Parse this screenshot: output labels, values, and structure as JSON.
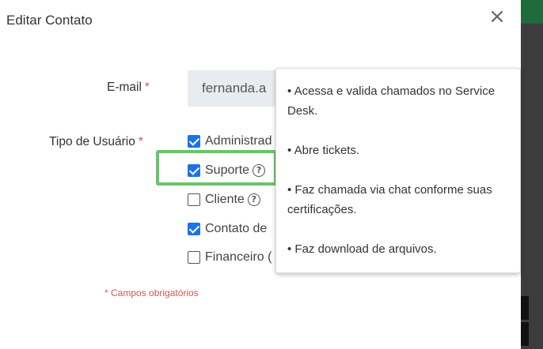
{
  "modal": {
    "title": "Editar Contato",
    "close_glyph": "×"
  },
  "form": {
    "email_label": "E-mail",
    "email_value": "fernanda.a",
    "user_type_label": "Tipo de Usuário",
    "required_marker": "*",
    "user_types": [
      {
        "label": "Administrad",
        "checked": true,
        "help": false
      },
      {
        "label": "Suporte",
        "checked": true,
        "help": true
      },
      {
        "label": "Cliente",
        "checked": false,
        "help": true
      },
      {
        "label": "Contato de",
        "checked": true,
        "help": false
      },
      {
        "label": "Financeiro (",
        "checked": false,
        "help": false
      }
    ],
    "required_note": "* Campos obrigatórios"
  },
  "tooltip": {
    "items": [
      "• Acessa e valida chamados no Service Desk.",
      "• Abre tickets.",
      "• Faz chamada via chat conforme suas certificações.",
      "• Faz download de arquivos."
    ]
  },
  "icons": {
    "help": "help-circle-icon",
    "close": "close-icon"
  },
  "colors": {
    "checkbox_checked": "#1a73e8",
    "required": "#d9534f",
    "highlight": "#6ac46a",
    "input_bg": "#e9ecef"
  }
}
